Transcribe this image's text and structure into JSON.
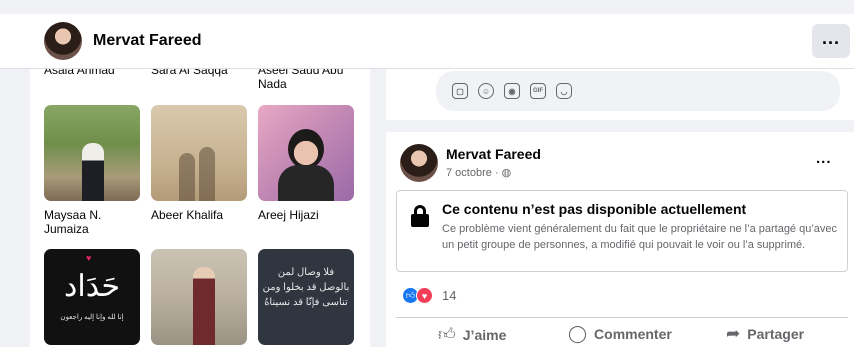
{
  "profile": {
    "name": "Mervat Fareed"
  },
  "header": {
    "more_label": "..."
  },
  "friends": {
    "top_row_names": [
      "Asala Ahmad",
      "Sara Al Saqqa",
      "Aseel Saud Abu Nada"
    ],
    "items": [
      {
        "name": "Maysaa N. Jumaiza"
      },
      {
        "name": "Abeer Khalifa"
      },
      {
        "name": "Areej Hijazi"
      },
      {
        "name": "",
        "photo_text": "حَدَاد",
        "photo_subtext": "إنا لله وإنا إليه راجعون"
      },
      {
        "name": ""
      },
      {
        "name": "",
        "photo_text": "فلا وصال لمن بالوصل قد بخلوا ومن تناسى فإنّا قد نسيناهُ"
      }
    ]
  },
  "composer": {
    "icons": [
      "sticker-icon",
      "emoji-icon",
      "camera-icon",
      "gif-icon",
      "sticker-smile-icon"
    ],
    "send_icon": "send-icon"
  },
  "post": {
    "author": "Mervat Fareed",
    "date": "7 octobre",
    "audience_icon": "globe-icon",
    "more_label": "...",
    "notice": {
      "title": "Ce contenu n’est pas disponible actuellement",
      "description": "Ce problème vient généralement du fait que le propriétaire ne l’a partagé qu’avec un petit groupe de personnes, a modifié qui pouvait le voir ou l’a supprimé."
    },
    "reactions": {
      "count": "14",
      "types": [
        "like",
        "love"
      ]
    },
    "actions": {
      "like": "J’aime",
      "comment": "Commenter",
      "share": "Partager"
    }
  },
  "colors": {
    "accent": "#1877f2",
    "love": "#f33e58",
    "secondary_text": "#65676b",
    "background": "#f0f2f5"
  }
}
